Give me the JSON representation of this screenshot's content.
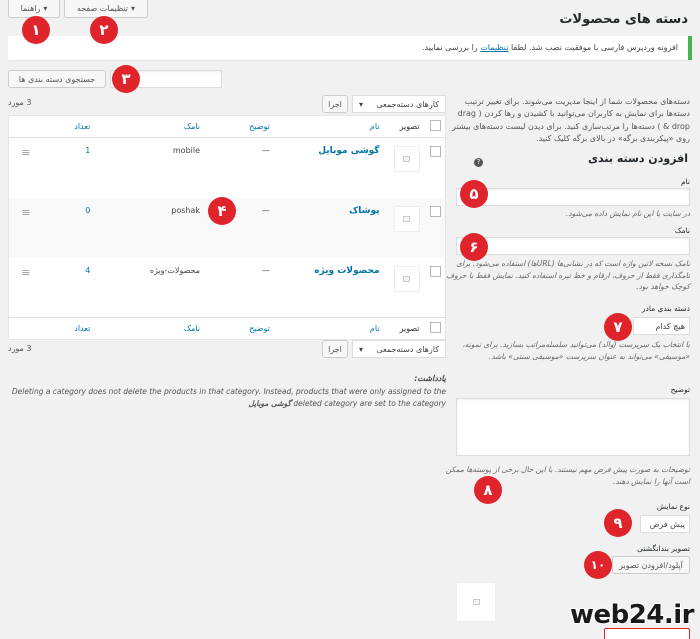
{
  "screen_options": {
    "help_label": "راهنما",
    "settings_label": "تنظیمات صفحه"
  },
  "page_title": "دسته های محصولات",
  "notice": {
    "before": "افزونه وردپرس فارسی با موفقیت نصب شد. لطفا",
    "link": "تنظیمات",
    "after": "را بررسی نمایید."
  },
  "search": {
    "button_label": "جستجوی دسته بندی ها",
    "value": ""
  },
  "bulk_top": {
    "select_value": "کارهای دسته‌جمعی",
    "apply_label": "اجرا",
    "count": "3 مورد"
  },
  "bulk_bottom": {
    "select_value": "کارهای دسته‌جمعی",
    "apply_label": "اجرا",
    "count": "3 مورد"
  },
  "table": {
    "columns": {
      "image": "تصویر",
      "name": "نام",
      "description": "توضیح",
      "slug": "نامک",
      "count": "تعداد"
    },
    "rows": [
      {
        "name": "گوشی موبایل",
        "description": "—",
        "slug": "mobile",
        "count": "1",
        "help_icon": true
      },
      {
        "name": "پوشاک",
        "description": "—",
        "slug": "poshak",
        "count": "0",
        "help_icon": false
      },
      {
        "name": "محصولات ویژه",
        "description": "—",
        "slug": "محصولات-ویژه",
        "count": "4",
        "help_icon": false
      }
    ]
  },
  "intro_text": "دسته‌های محصولات شما از اینجا مدیریت می‌شوند. برای تغییر ترتیب دسته‌ها برای نمایش به کاربران می‌توانید با کشیدن و رها کردن ( drag & drop ) دسته‌ها را مرتب‌سازی کنید. برای دیدن لیست دسته‌های بیشتر روی «پیکربندی برگه» در بالای برگه کلیک کنید.",
  "add_form": {
    "heading": "افزودن دسته بندی",
    "name_label": "نام",
    "name_hint": "در سایت با این نام نمایش داده می‌شود.",
    "slug_label": "نامک",
    "slug_hint": "نامک نسخه لاتین واژه است که در نشانی‌ها (URLها) استفاده می‌شود. برای نامگذاری فقط از حروف، ارقام و خط تیره استفاده کنید. نمایش فقط با حروف کوچک خواهد بود.",
    "parent_label": "دسته بندی مادر",
    "parent_value": "هیچ کدام",
    "parent_hint": "با انتخاب یک سرپرست (والد) می‌توانید سلسله‌مراتب بسازید. برای نمونه، «موسیقی» می‌تواند به عنوان سرپرست «موسیقی سنتی» باشد.",
    "description_label": "توضیح",
    "description_hint": "توضیحات به صورت پیش فرض مهم نیستند. با این حال برخی از پوسته‌ها ممکن است آنها را نمایش دهند.",
    "display_type_label": "نوع نمایش",
    "display_type_value": "پیش فرض",
    "thumbnail_label": "تصویر بندانگشتی",
    "upload_label": "آپلود/افزودن تصویر"
  },
  "note": {
    "title": "یادداشت:",
    "text_en_1": "Deleting a category does not delete the products in that category. Instead, products that were only assigned to the",
    "text_en_2": "deleted category are set to the category",
    "default_cat": "گوشی موبایل"
  },
  "markers": [
    "۱",
    "۲",
    "۳",
    "۴",
    "۵",
    "۶",
    "۷",
    "۸",
    "۹",
    "۱۰"
  ],
  "watermark": {
    "text": "web24.ir"
  }
}
